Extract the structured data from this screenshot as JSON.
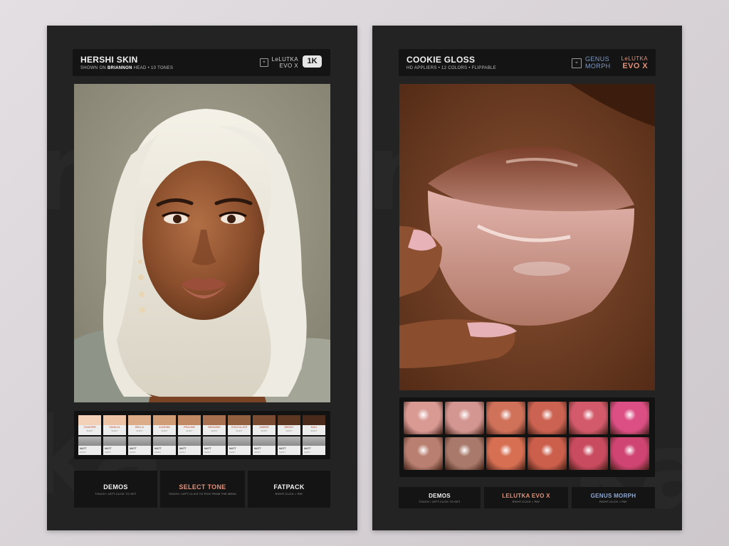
{
  "left_panel": {
    "title": "HERSHI SKIN",
    "subtitle_pre": "SHOWN ON ",
    "subtitle_bold": "BRIANNON",
    "subtitle_post": " HEAD  •  10 TONES",
    "brand_box": "⌖",
    "brand_line1": "LeLUTKA",
    "brand_line2": "EVO X",
    "badge": "1K",
    "tones": [
      {
        "label": "TOASTER",
        "sub": "SHINY",
        "color": "#f3d1b8"
      },
      {
        "label": "VANILLA",
        "sub": "SHINY",
        "color": "#ecc3a5"
      },
      {
        "label": "BELLA",
        "sub": "SHINY",
        "color": "#dcac88"
      },
      {
        "label": "ALMOND",
        "sub": "SHINY",
        "color": "#cf9c76"
      },
      {
        "label": "PRALINE",
        "sub": "SHINY",
        "color": "#c18a64"
      },
      {
        "label": "BROWNIE",
        "sub": "SHINY",
        "color": "#a8704e"
      },
      {
        "label": "CHOCOLATE",
        "sub": "SHINY",
        "color": "#92603f"
      },
      {
        "label": "AMBER",
        "sub": "SHINY",
        "color": "#7a4b30"
      },
      {
        "label": "EBONY",
        "sub": "SHINY",
        "color": "#5e3722"
      },
      {
        "label": "NALI",
        "sub": "SHINY",
        "color": "#4a2b1b"
      }
    ],
    "matt_label": "MATT",
    "matt_sub": "SHINY",
    "buttons": [
      {
        "label": "DEMOS",
        "sub": "TOUCH / LEFT-CLICK TO GET"
      },
      {
        "label": "SELECT TONE",
        "sub": "TOUCH / LEFT-CLICK TO PICK FROM THE MENU"
      },
      {
        "label": "FATPACK",
        "sub": "RIGHT-CLICK > PAY"
      }
    ]
  },
  "right_panel": {
    "title": "COOKIE GLOSS",
    "subtitle": "HD APPLIERS  •  12 COLORS  •  FLIPPABLE",
    "brand_box": "⌖",
    "brand_genus_line1": "GENUS",
    "brand_genus_line2": "MORPH",
    "brand_lelutka_line1": "LeLUTKA",
    "brand_lelutka_line2": "EVO X",
    "lip_colors": [
      "#d99a94",
      "#d39690",
      "#d0715a",
      "#cc6352",
      "#d35a6a",
      "#dc4f84",
      "#b98071",
      "#a97a6b",
      "#d76f52",
      "#cc5f4c",
      "#c94b5f",
      "#cf4472"
    ],
    "buttons": [
      {
        "label": "DEMOS",
        "sub": "TOUCH / LEFT-CLICK TO GET"
      },
      {
        "label": "LELUTKA EVO X",
        "sub": "RIGHT-CLICK > PAY"
      },
      {
        "label": "GENUS MORPH",
        "sub": "RIGHT-CLICK > PAY"
      }
    ]
  },
  "colors": {
    "panel_bg": "#232323",
    "header_bg": "#141414",
    "accent": "#e3907a",
    "genus_blue": "#6f8fbf",
    "lelutka_pink": "#e3907a"
  }
}
